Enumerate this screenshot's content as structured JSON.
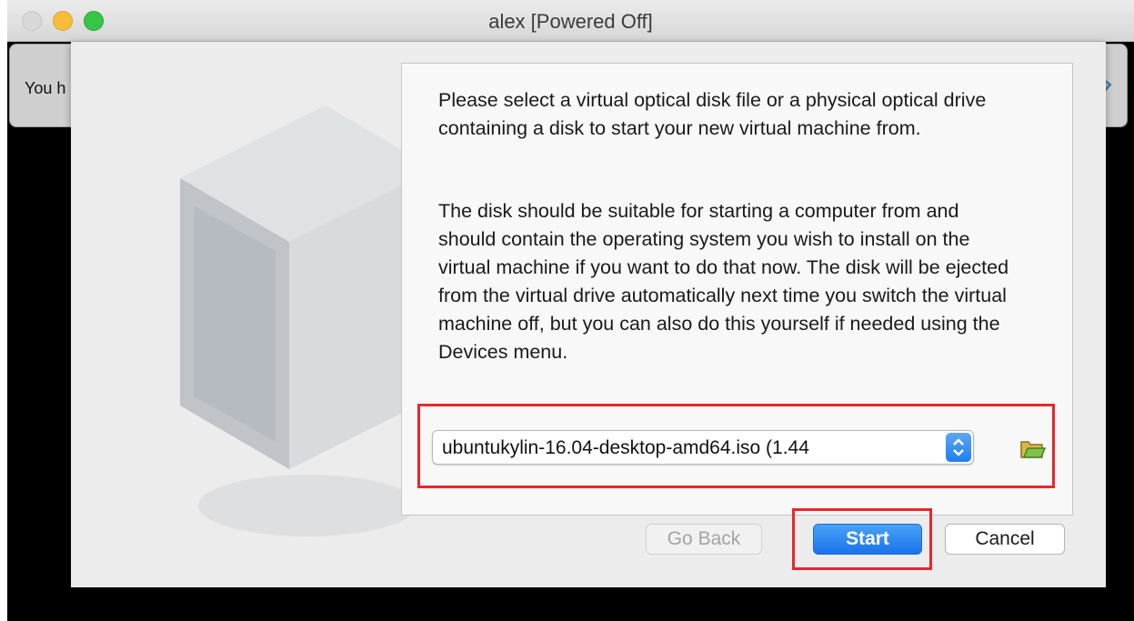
{
  "window": {
    "title": "alex [Powered Off]"
  },
  "vm_banner": {
    "text": "You h"
  },
  "dialog": {
    "paragraph1": "Please select a virtual optical disk file or a physical optical drive containing a disk to start your new virtual machine from.",
    "paragraph2": "The disk should be suitable for starting a computer from and should contain the operating system you wish to install on the virtual machine if you want to do that now. The disk will be ejected from the virtual drive automatically next time you switch the virtual machine off, but you can also do this yourself if needed using the Devices menu.",
    "disk_select": {
      "selected": "ubuntukylin-16.04-desktop-amd64.iso (1.44"
    },
    "buttons": {
      "back": "Go Back",
      "start": "Start",
      "cancel": "Cancel"
    }
  },
  "colors": {
    "accent": "#1a73ea",
    "highlight": "#e8272a"
  },
  "icons": {
    "logo": "virtualbox-oracle-logo",
    "folder": "folder-open-icon",
    "combo": "chevron-updown-icon"
  }
}
